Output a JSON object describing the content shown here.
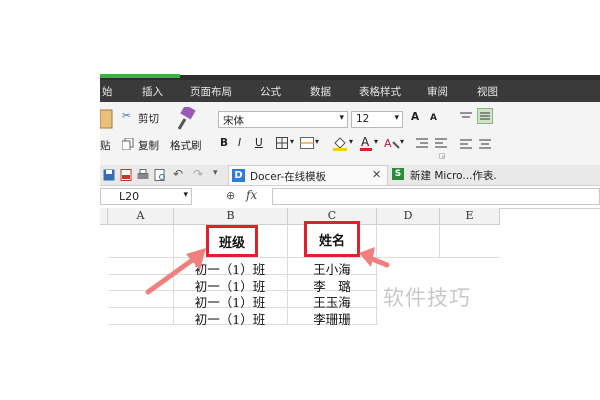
{
  "menu": {
    "items": [
      "始",
      "插入",
      "页面布局",
      "公式",
      "数据",
      "表格样式",
      "审阅",
      "视图"
    ]
  },
  "ribbon": {
    "cut": "剪切",
    "copy": "复制",
    "format_painter": "格式刷",
    "paste_partial": "贴",
    "font_name": "宋体",
    "font_size": "12",
    "bold": "B",
    "italic": "I",
    "underline": "U",
    "grow_font": "A",
    "shrink_font": "A"
  },
  "tabs": {
    "docer": "Docer-在线模板",
    "new_file": "新建 Micro...作表."
  },
  "formula_bar": {
    "cell_ref": "L20",
    "fx": "fx"
  },
  "columns": [
    "A",
    "B",
    "C",
    "D",
    "E"
  ],
  "headers": {
    "class": "班级",
    "name": "姓名"
  },
  "rows": [
    {
      "class": "初一（1）班",
      "name": "王小海"
    },
    {
      "class": "初一（1）班",
      "name": "李　璐"
    },
    {
      "class": "初一（1）班",
      "name": "王玉海"
    },
    {
      "class": "初一（1）班",
      "name": "李珊珊"
    }
  ],
  "watermark": "软件技巧",
  "colors": {
    "highlight_box": "#e0202a",
    "arrow": "#f08080",
    "active_tab": "#3cb043"
  }
}
